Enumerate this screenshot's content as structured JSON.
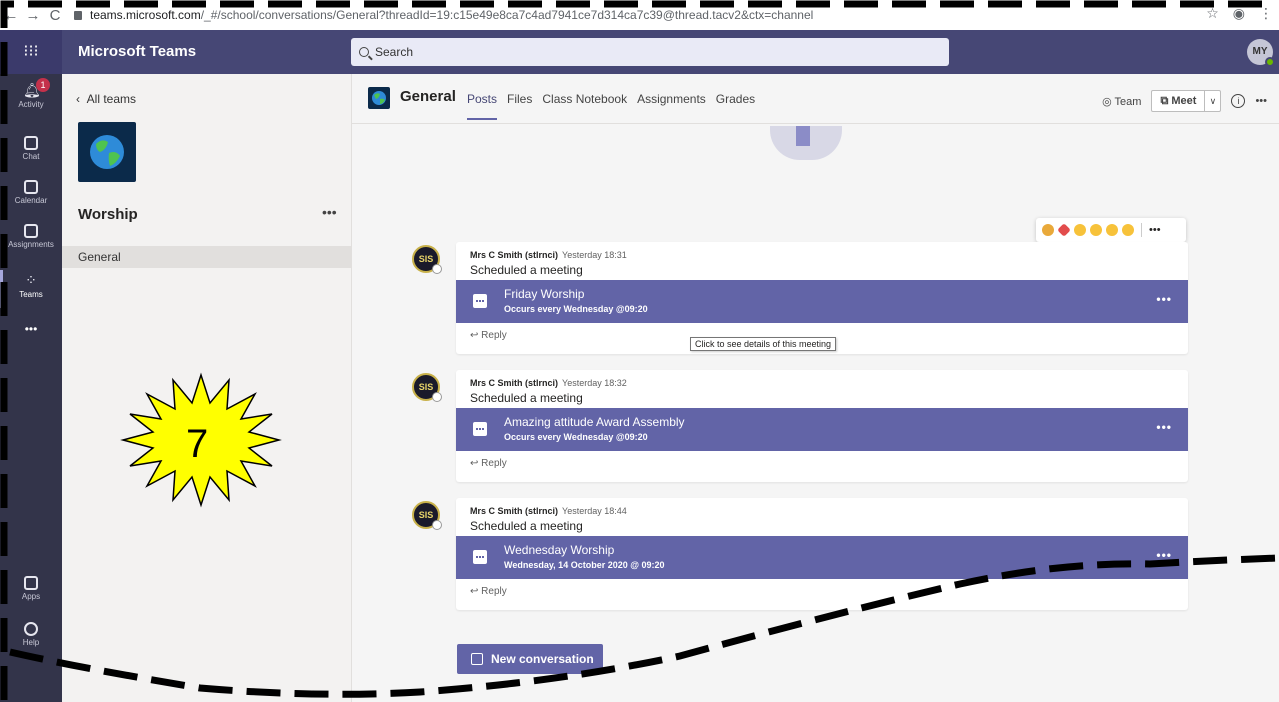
{
  "browser": {
    "back": "←",
    "forward": "→",
    "reload": "C",
    "url_host": "teams.microsoft.com",
    "url_path": "/_#/school/conversations/General?threadId=19:c15e49e8ca7c4ad7941ce7d314ca7c39@thread.tacv2&ctx=channel"
  },
  "header": {
    "app_title": "Microsoft Teams",
    "search_placeholder": "Search",
    "avatar_initials": "MY"
  },
  "app_rail": {
    "activity_badge": "1",
    "items": [
      {
        "label": "Activity",
        "icon": "bell-icon"
      },
      {
        "label": "Chat",
        "icon": "chat-icon"
      },
      {
        "label": "Calendar",
        "icon": "calendar-icon"
      },
      {
        "label": "Assignments",
        "icon": "assignments-icon"
      },
      {
        "label": "Teams",
        "icon": "teams-icon"
      },
      {
        "label": "Apps",
        "icon": "apps-icon"
      },
      {
        "label": "Help",
        "icon": "help-icon"
      }
    ],
    "more_label": "•••"
  },
  "left_panel": {
    "back_label": "All teams",
    "team_name": "Worship",
    "more": "•••",
    "channels": [
      {
        "label": "General"
      }
    ]
  },
  "channel": {
    "title": "General",
    "tabs": [
      "Posts",
      "Files",
      "Class Notebook",
      "Assignments",
      "Grades"
    ],
    "active_tab": "Posts",
    "team_label": "Team",
    "meet_label": "Meet",
    "info": "i",
    "more": "•••"
  },
  "reactions": [
    "like",
    "heart",
    "laugh",
    "surprised",
    "sad",
    "angry"
  ],
  "messages": [
    {
      "avatar": "SIS",
      "author": "Mrs C Smith (stlrnci)",
      "time": "Yesterday 18:31",
      "text": "Scheduled a meeting",
      "meeting_title": "Friday Worship",
      "meeting_sub": "Occurs every Wednesday @09:20",
      "reply": "Reply"
    },
    {
      "avatar": "SIS",
      "author": "Mrs C Smith (stlrnci)",
      "time": "Yesterday 18:32",
      "text": "Scheduled a meeting",
      "meeting_title": "Amazing attitude Award Assembly",
      "meeting_sub": "Occurs every Wednesday @09:20",
      "reply": "Reply"
    },
    {
      "avatar": "SIS",
      "author": "Mrs C Smith (stlrnci)",
      "time": "Yesterday 18:44",
      "text": "Scheduled a meeting",
      "meeting_title": "Wednesday Worship",
      "meeting_sub": "Wednesday, 14 October 2020 @ 09:20",
      "reply": "Reply"
    }
  ],
  "tooltip": "Click to see details of this meeting",
  "new_conversation": "New conversation",
  "annotation": {
    "step_number": "7",
    "burst_color": "#ffff00"
  },
  "colors": {
    "brand": "#464775",
    "accent": "#6264a7",
    "rail": "#33344a"
  }
}
